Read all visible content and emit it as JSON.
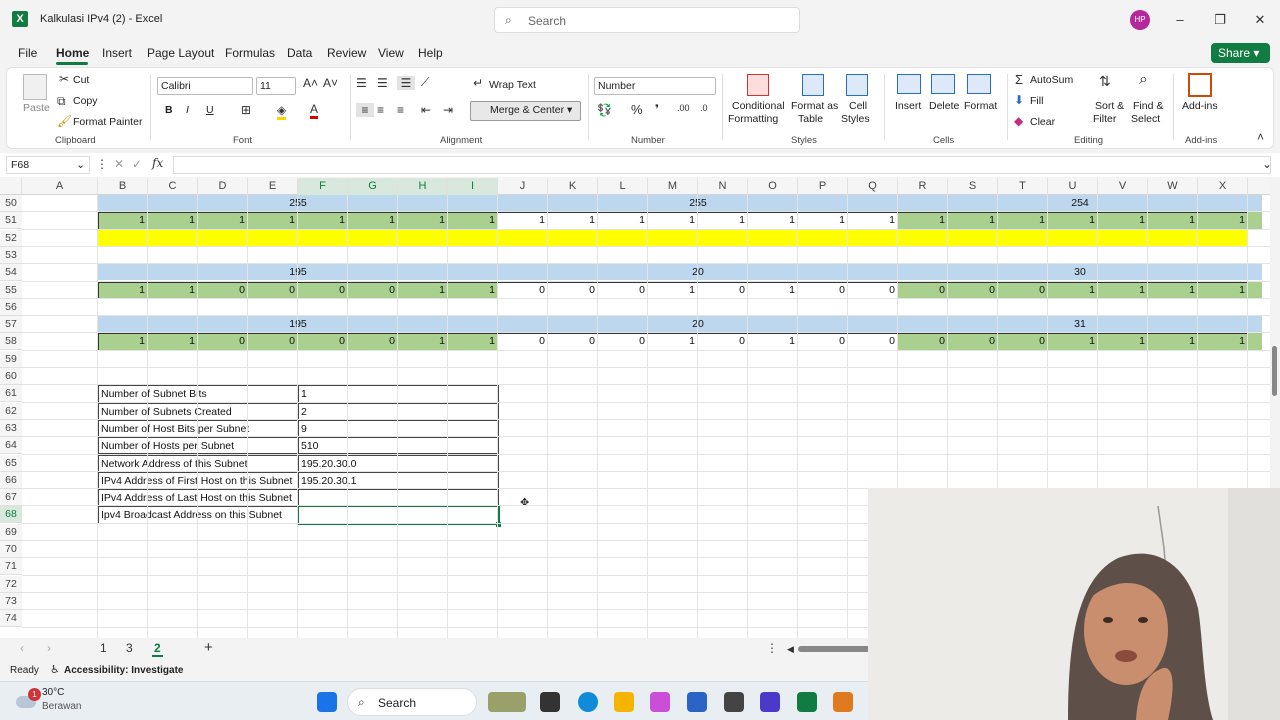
{
  "window": {
    "title": "Kalkulasi IPv4 (2)  -  Excel",
    "search_placeholder": "Search",
    "avatar_initials": "HP"
  },
  "menu": [
    "File",
    "Home",
    "Insert",
    "Page Layout",
    "Formulas",
    "Data",
    "Review",
    "View",
    "Help"
  ],
  "share_label": "Share",
  "ribbon": {
    "clipboard": {
      "paste": "Paste",
      "cut": "Cut",
      "copy": "Copy",
      "format_painter": "Format Painter",
      "group": "Clipboard"
    },
    "font": {
      "name": "Calibri",
      "size": "11",
      "bold": "B",
      "italic": "I",
      "underline": "U",
      "group": "Font"
    },
    "alignment": {
      "wrap": "Wrap Text",
      "merge": "Merge & Center",
      "group": "Alignment"
    },
    "number": {
      "format": "Number",
      "group": "Number"
    },
    "styles": {
      "conditional": "Conditional",
      "conditional2": "Formatting",
      "format_as": "Format as",
      "table": "Table",
      "cell": "Cell",
      "styles": "Styles",
      "group": "Styles"
    },
    "cells": {
      "insert": "Insert",
      "delete": "Delete",
      "format": "Format",
      "group": "Cells"
    },
    "editing": {
      "autosum": "AutoSum",
      "fill": "Fill",
      "clear": "Clear",
      "sort": "Sort &",
      "filter": "Filter",
      "find": "Find &",
      "select": "Select",
      "group": "Editing"
    },
    "addins": {
      "label": "Add-ins",
      "group": "Add-ins"
    }
  },
  "name_box": "F68",
  "fx": "fx",
  "columns": [
    "A",
    "B",
    "C",
    "D",
    "E",
    "F",
    "G",
    "H",
    "I",
    "J",
    "K",
    "L",
    "M",
    "N",
    "O",
    "P",
    "Q",
    "R",
    "S",
    "T",
    "U",
    "V",
    "W",
    "X"
  ],
  "rows": [
    "50",
    "51",
    "52",
    "53",
    "54",
    "55",
    "56",
    "57",
    "58",
    "59",
    "60",
    "61",
    "62",
    "63",
    "64",
    "65",
    "66",
    "67",
    "68",
    "69",
    "70",
    "71",
    "72",
    "73",
    "74"
  ],
  "octets_row50": [
    "255",
    "255",
    "254"
  ],
  "bits_row51": [
    "1",
    "1",
    "1",
    "1",
    "1",
    "1",
    "1",
    "1",
    "1",
    "1",
    "1",
    "1",
    "1",
    "1",
    "1",
    "1",
    "1",
    "1",
    "1",
    "1",
    "1",
    "1",
    "1"
  ],
  "octets_row54": [
    "195",
    "20",
    "30"
  ],
  "bits_row55": [
    "1",
    "1",
    "0",
    "0",
    "0",
    "0",
    "1",
    "1",
    "0",
    "0",
    "0",
    "1",
    "0",
    "1",
    "0",
    "0",
    "0",
    "0",
    "0",
    "1",
    "1",
    "1",
    "1"
  ],
  "octets_row57": [
    "195",
    "20",
    "31"
  ],
  "bits_row58": [
    "1",
    "1",
    "0",
    "0",
    "0",
    "0",
    "1",
    "1",
    "0",
    "0",
    "0",
    "1",
    "0",
    "1",
    "0",
    "0",
    "0",
    "0",
    "0",
    "1",
    "1",
    "1",
    "1"
  ],
  "info_table": [
    {
      "label": "Number of Subnet Bits",
      "value": "1"
    },
    {
      "label": "Number of Subnets Created",
      "value": "2"
    },
    {
      "label": "Number of Host Bits per Subnet",
      "value": "9"
    },
    {
      "label": "Number of Hosts per Subnet",
      "value": "510"
    },
    {
      "label": "Network Address of this Subnet",
      "value": "195.20.30.0"
    },
    {
      "label": "IPv4 Address of First Host on this Subnet",
      "value": "195.20.30.1"
    },
    {
      "label": "IPv4 Address of Last Host on this Subnet",
      "value": ""
    },
    {
      "label": "Ipv4 Broadcast Address on this Subnet",
      "value": ""
    }
  ],
  "sheet_tabs": [
    "1",
    "3",
    "2"
  ],
  "status": {
    "ready": "Ready",
    "accessibility": "Accessibility: Investigate"
  },
  "weather": {
    "temp": "30°C",
    "desc": "Berawan",
    "badge": "1"
  },
  "taskbar_search": "Search",
  "colors": {
    "excel_green": "#107c41",
    "header_blue": "#bdd7ee",
    "bit_green": "#a9d08e",
    "highlight_yellow": "#ffff00"
  }
}
